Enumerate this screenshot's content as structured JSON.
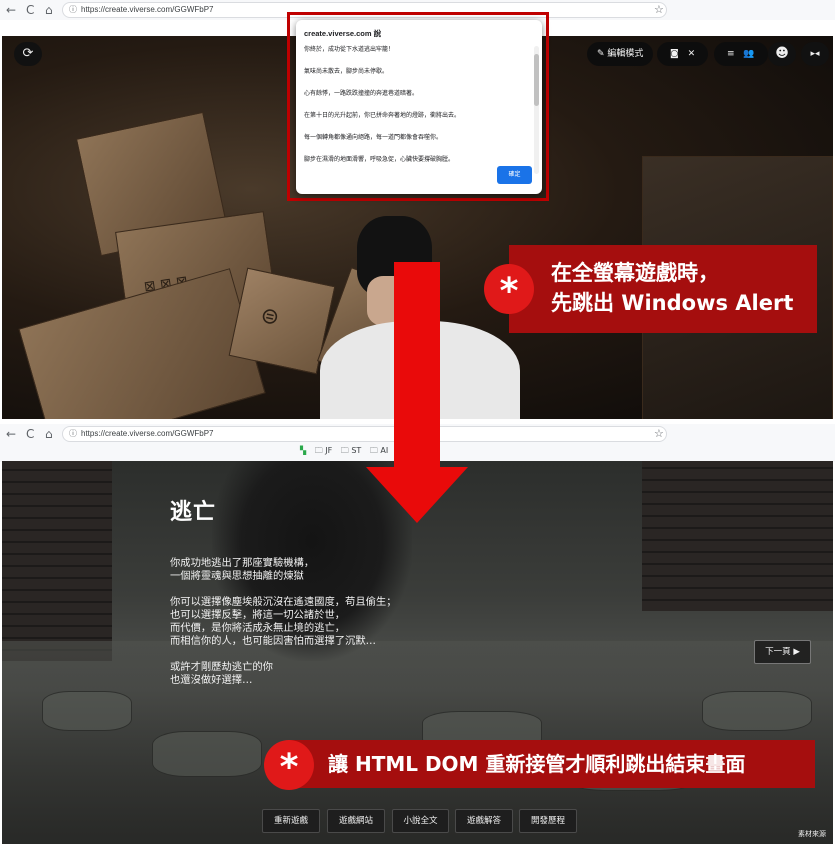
{
  "browser_top": {
    "url": "https://create.viverse.com/GGWFbP7",
    "nav": {
      "back": "←",
      "reload": "C",
      "home": "⌂"
    }
  },
  "browser_bottom": {
    "url": "https://create.viverse.com/GGWFbP7",
    "bookmarks": [
      "JF",
      "ST",
      "AI"
    ]
  },
  "game_toolbar": {
    "edit_mode_label": "編輯模式"
  },
  "alert": {
    "host": "create.viverse.com 說",
    "messages": [
      "你終於，成功從下水道逃出牢籠！",
      "氣味尚未散去，腳步尚未停歇。",
      "心有餘悸，一路跌跌撞撞的奔進巷道暗著。",
      "在第十日的光升起前，你已拼命奔著地的燈跡，衝將出去。",
      "每一個轉角都像通向絕路，每一道門都像會吞噬你。",
      "腳步在濕滑的地面滑響，呼吸急促，心臟快要撐破胸膛。"
    ],
    "ok_label": "確定"
  },
  "callout_top": {
    "star": "*",
    "line1": "在全螢幕遊戲時，",
    "line2": "先跳出 Windows Alert"
  },
  "callout_bottom": {
    "star": "*",
    "text": "讓 HTML DOM 重新接管才順利跳出結束畫面"
  },
  "ending": {
    "title": "逃亡",
    "para1": [
      "你成功地逃出了那座實驗機構，",
      "一個將靈魂與思想抽離的煉獄"
    ],
    "para2": [
      "你可以選擇像塵埃般沉沒在遙遠國度，苟且偷生；",
      "也可以選擇反擊，將這一切公諸於世，",
      "而代價，是你將活成永無止境的逃亡，",
      "而相信你的人，也可能因害怕而選擇了沉默…"
    ],
    "para3": [
      "或許才剛歷劫逃亡的你",
      "也還沒做好選擇…"
    ],
    "next_label": "下一頁 ▶",
    "buttons": [
      "重新遊戲",
      "遊戲網站",
      "小說全文",
      "遊戲解答",
      "開發歷程"
    ],
    "credit": "素材來源"
  }
}
